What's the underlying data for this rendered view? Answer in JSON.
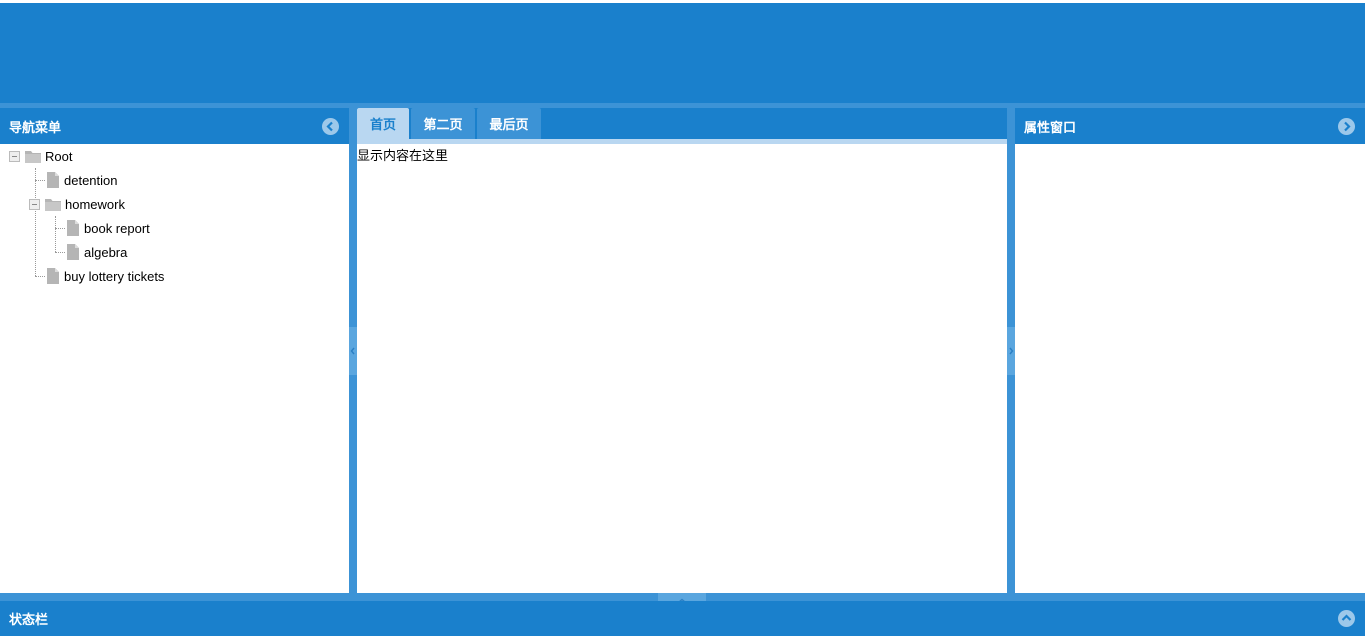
{
  "west": {
    "title": "导航菜单",
    "tree": {
      "root": "Root",
      "detention": "detention",
      "homework": "homework",
      "book_report": "book report",
      "algebra": "algebra",
      "lottery": "buy lottery tickets"
    }
  },
  "center": {
    "tabs": [
      {
        "label": "首页"
      },
      {
        "label": "第二页"
      },
      {
        "label": "最后页"
      }
    ],
    "content": "显示内容在这里"
  },
  "east": {
    "title": "属性窗口"
  },
  "south": {
    "title": "状态栏"
  },
  "colors": {
    "header_bg": "#1a80cc",
    "frame_bg": "#3c93d6",
    "tab_active_bg": "#b9d7f1"
  }
}
